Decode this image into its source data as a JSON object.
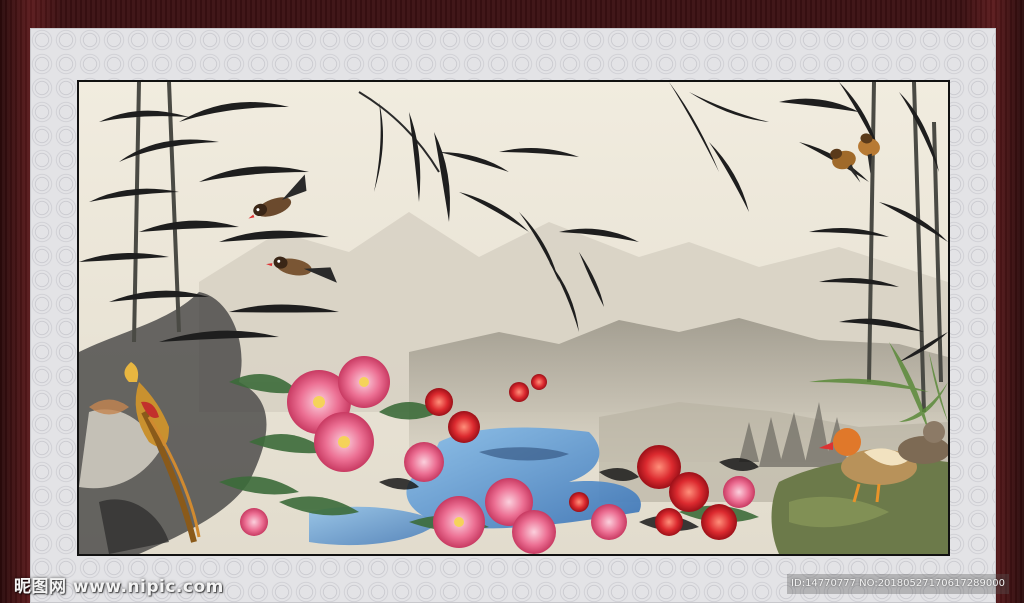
{
  "watermark": {
    "logo_text": "昵图网 www.nipic.com",
    "id_text": "ID:14770777 NO:20180527170617289000"
  },
  "colors": {
    "frame": "#3b1012",
    "mat": "#e3e3e6",
    "paper": "#efe9da",
    "ink": "#1e1e1e",
    "peony_pink": "#e8688a",
    "peony_red": "#d8222b",
    "rock_blue": "#6a9fd4"
  }
}
